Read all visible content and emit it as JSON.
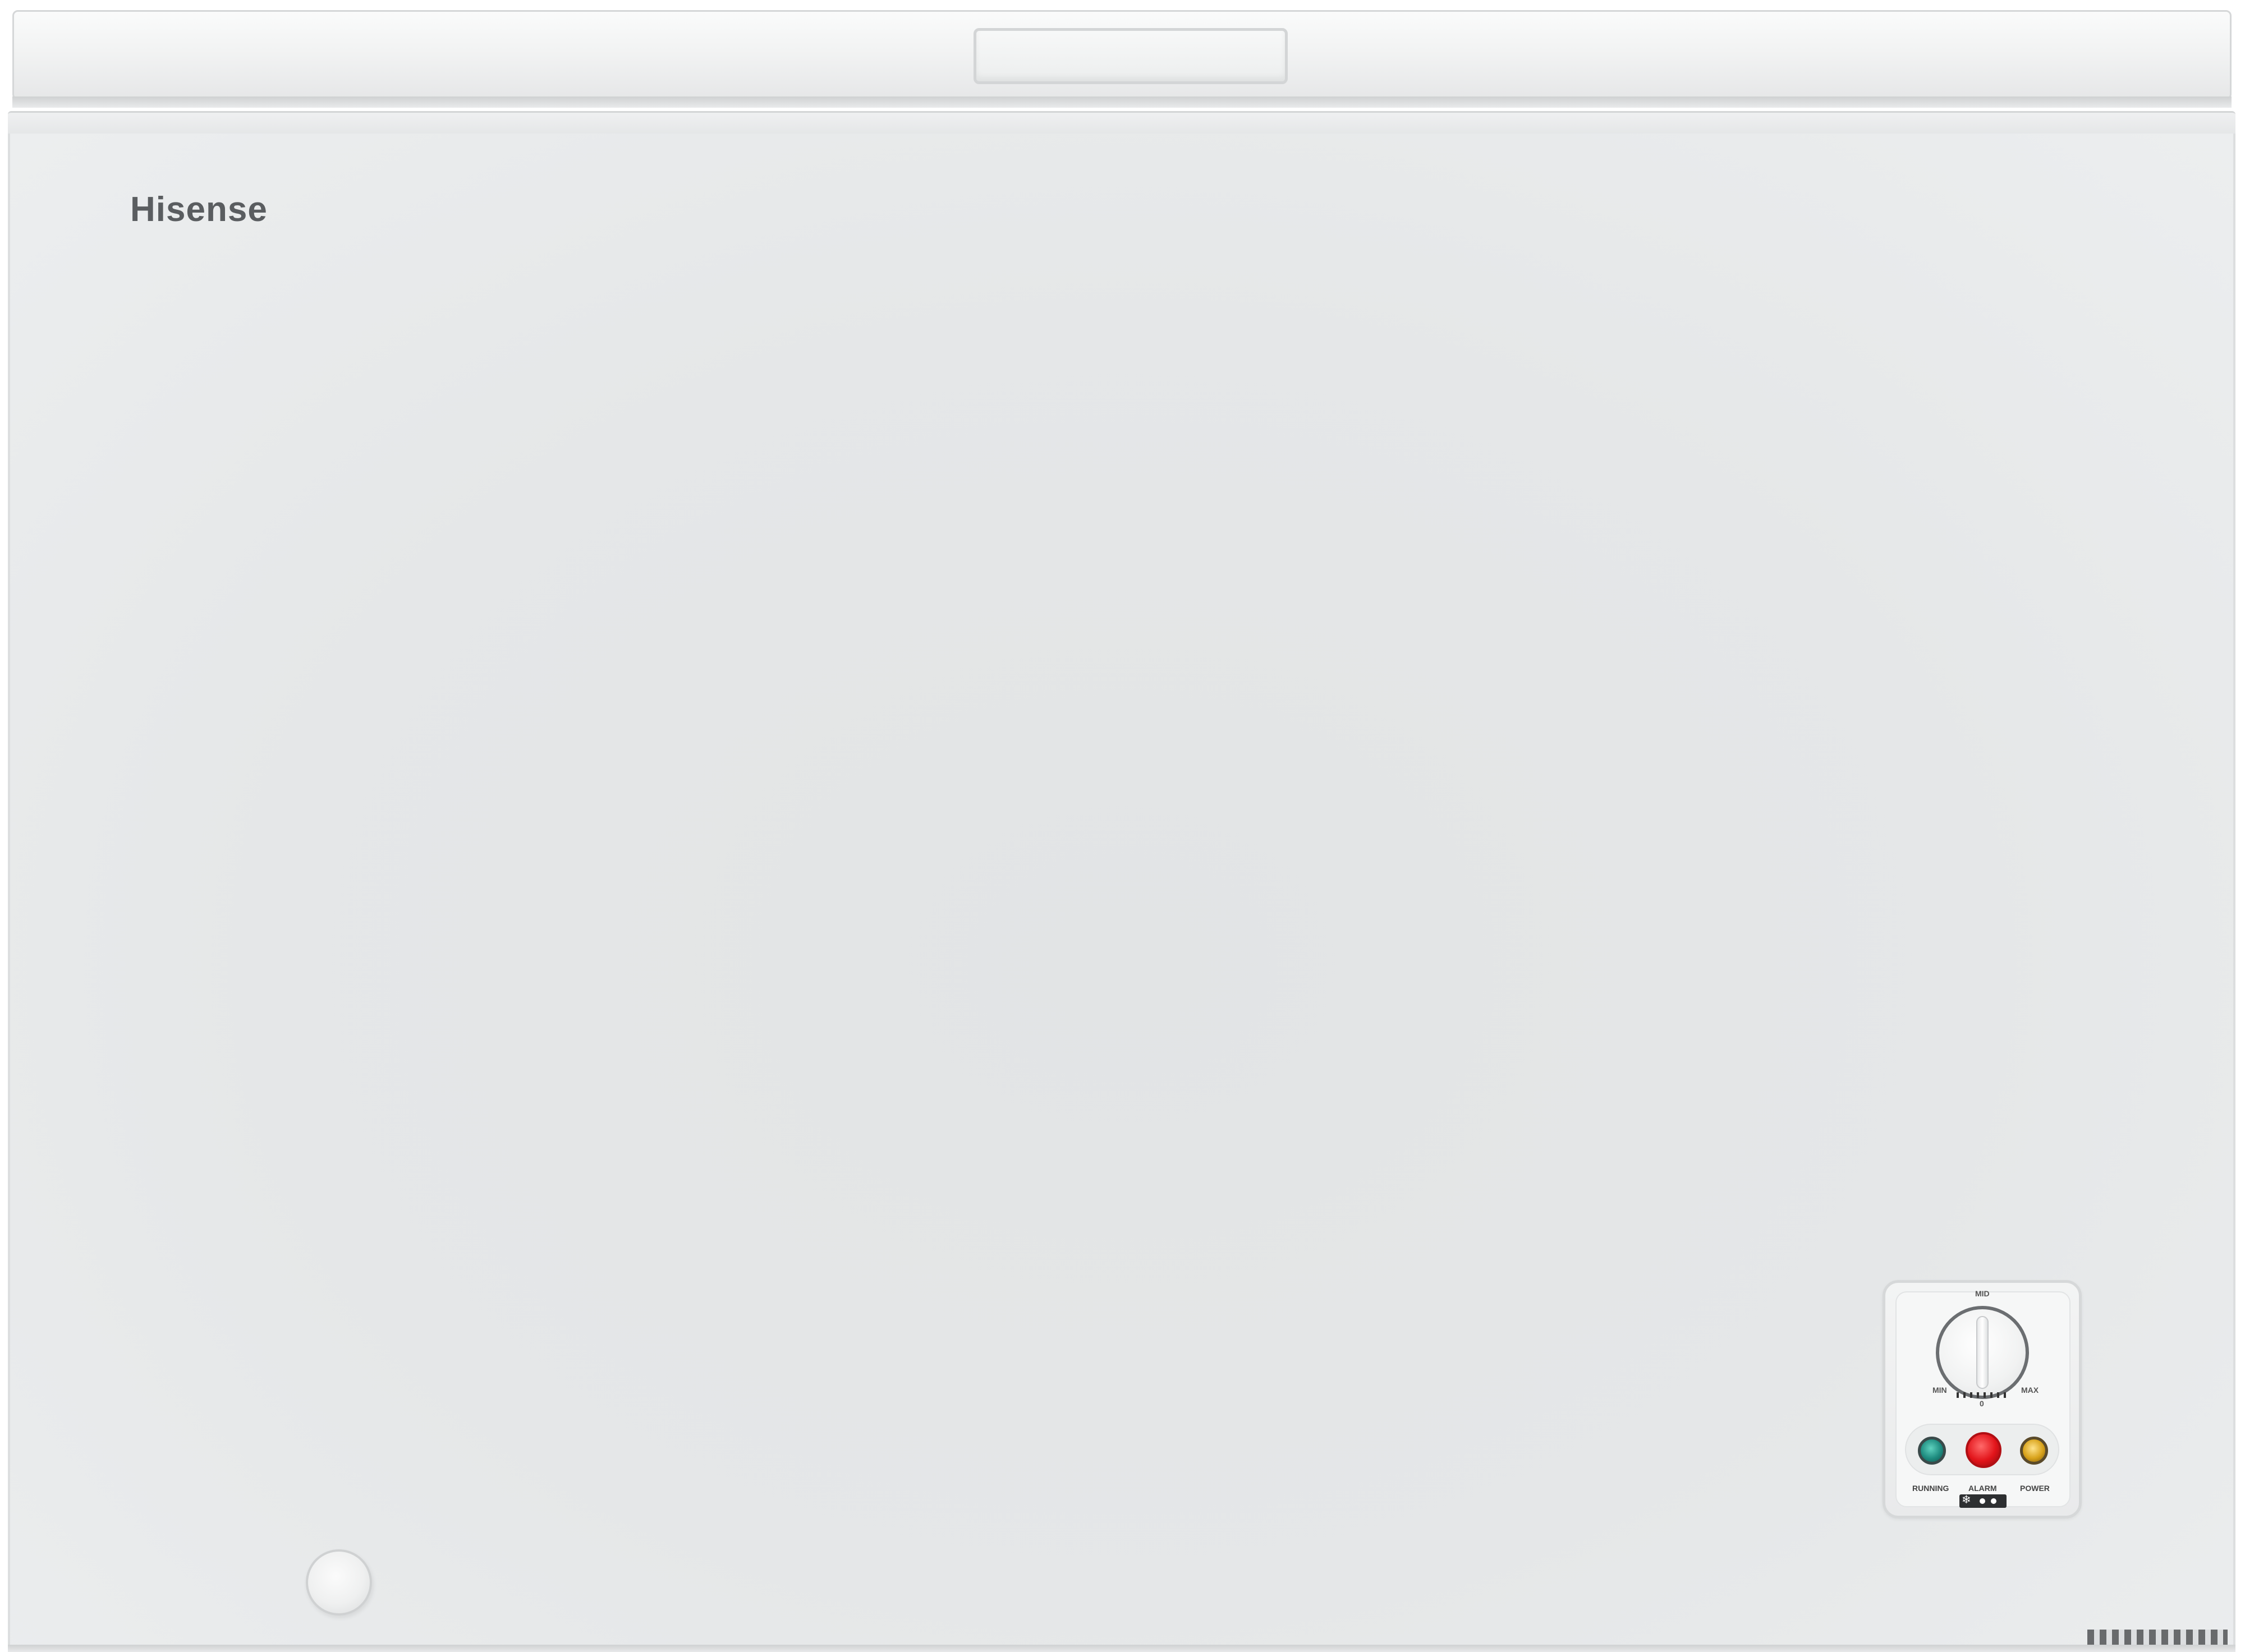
{
  "brand": {
    "logo_text": "Hisense"
  },
  "control_panel": {
    "dial": {
      "label_mid": "MID",
      "label_min": "MIN",
      "label_max": "MAX",
      "label_zero": "0"
    },
    "indicators": [
      {
        "label": "RUNNING",
        "color": "#1f8c80"
      },
      {
        "label": "ALARM",
        "color": "#e2141a"
      },
      {
        "label": "POWER",
        "color": "#d8a21a"
      }
    ],
    "fast_freeze_icon": "snowflake-icon"
  },
  "colors": {
    "cabinet": "#e5e7e8",
    "brand_text": "#5a5d60"
  }
}
